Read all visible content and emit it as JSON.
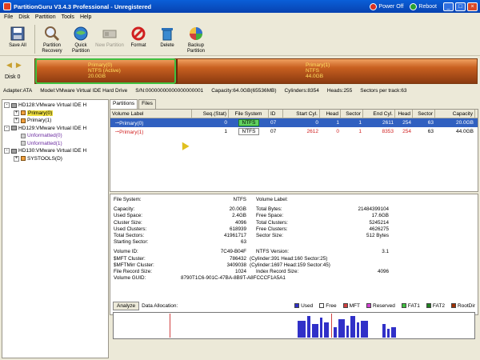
{
  "window": {
    "title": "PartitionGuru V3.4.3 Professional - Unregistered",
    "power_off": "Power Off",
    "reboot": "Reboot"
  },
  "menu": [
    "File",
    "Disk",
    "Partition",
    "Tools",
    "Help"
  ],
  "toolbar": [
    {
      "label": "Save All",
      "icon": "save-icon",
      "enabled": true
    },
    {
      "label": "Partition Recovery",
      "icon": "magnifier-icon",
      "enabled": true
    },
    {
      "label": "Quick Partition",
      "icon": "globe-icon",
      "enabled": true
    },
    {
      "label": "New Partition",
      "icon": "new-partition-icon",
      "enabled": false
    },
    {
      "label": "Format",
      "icon": "format-icon",
      "enabled": true
    },
    {
      "label": "Delete",
      "icon": "trash-icon",
      "enabled": true
    },
    {
      "label": "Backup Partition",
      "icon": "backup-icon",
      "enabled": true
    }
  ],
  "diskmap": {
    "disk_label": "Disk  0",
    "partitions": [
      {
        "name": "Primary(0)",
        "fs": "NTFS (Active)",
        "size": "20.0GB"
      },
      {
        "name": "Primary(1)",
        "fs": "NTFS",
        "size": "44.0GB"
      }
    ]
  },
  "info": {
    "adapter": "Adapter:ATA",
    "model": "Model:VMware Virtual IDE Hard Drive",
    "sn": "S/N:00000000000000000001",
    "capacity": "Capacity:64.0GB(65536MB)",
    "cylinders": "Cylinders:8354",
    "heads": "Heads:255",
    "sectors": "Sectors per track:63"
  },
  "tree": [
    {
      "level": 1,
      "type": "disk",
      "label": "HD128:VMware Virtual IDE H",
      "exp": "-"
    },
    {
      "level": 2,
      "type": "part",
      "label": "Primary(0)",
      "exp": "+",
      "selected": true
    },
    {
      "level": 2,
      "type": "part",
      "label": "Primary(1)",
      "exp": "+"
    },
    {
      "level": 1,
      "type": "disk",
      "label": "HD129:VMware Virtual IDE H",
      "exp": "-"
    },
    {
      "level": 2,
      "type": "unf",
      "label": "Unformatted(0)",
      "exp": ""
    },
    {
      "level": 2,
      "type": "unf",
      "label": "Unformatted(1)",
      "exp": ""
    },
    {
      "level": 1,
      "type": "disk",
      "label": "HD130:VMware Virtual IDE H",
      "exp": "-"
    },
    {
      "level": 2,
      "type": "part",
      "label": "SYSTOOLS(D)",
      "exp": "+"
    }
  ],
  "tabs": [
    "Partitions",
    "Files"
  ],
  "table": {
    "headers": [
      "Volume Label",
      "Seq.(Stat)",
      "File System",
      "ID",
      "Start Cyl.",
      "Head",
      "Sector",
      "End Cyl.",
      "Head",
      "Sector",
      "Capacity"
    ],
    "rows": [
      {
        "label": "Primary(0)",
        "seq": "0",
        "fs": "NTFS",
        "id": "07",
        "start_cyl": "0",
        "head": "1",
        "sector": "1",
        "end_cyl": "2611",
        "end_head": "254",
        "end_sector": "63",
        "capacity": "20.0GB"
      },
      {
        "label": "Primary(1)",
        "seq": "1",
        "fs": "NTFS",
        "id": "07",
        "start_cyl": "2612",
        "head": "0",
        "sector": "1",
        "end_cyl": "8353",
        "end_head": "254",
        "end_sector": "63",
        "capacity": "44.0GB"
      }
    ]
  },
  "details": {
    "file_system_k": "File System:",
    "file_system_v": "NTFS",
    "volume_label_k": "Volume Label:",
    "volume_label_v": "",
    "capacity_k": "Capacity:",
    "capacity_v": "20.0GB",
    "total_bytes_k": "Total Bytes:",
    "total_bytes_v": "21484399104",
    "used_k": "Used Space:",
    "used_v": "2.4GB",
    "free_k": "Free Space:",
    "free_v": "17.6GB",
    "cluster_size_k": "Cluster Size:",
    "cluster_size_v": "4096",
    "total_clusters_k": "Total Clusters:",
    "total_clusters_v": "5245214",
    "used_clusters_k": "Used Clusters:",
    "used_clusters_v": "618939",
    "free_clusters_k": "Free Clusters:",
    "free_clusters_v": "4626275",
    "total_sectors_k": "Total Sectors:",
    "total_sectors_v": "41961717",
    "sector_size_k": "Sector Size:",
    "sector_size_v": "512 Bytes",
    "starting_sector_k": "Starting Sector:",
    "starting_sector_v": "63",
    "volume_id_k": "Volume ID:",
    "volume_id_v": "7C49-B04F",
    "ntfs_version_k": "NTFS Version:",
    "ntfs_version_v": "3.1",
    "mft_cluster_k": "$MFT Cluster:",
    "mft_cluster_v": "786432",
    "mft_cluster_x": "(Cylinder:391 Head:160 Sector:25)",
    "mftmirr_k": "$MFTMirr Cluster:",
    "mftmirr_v": "3409038",
    "mftmirr_x": "(Cylinder:1697 Head:159 Sector:45)",
    "frs_k": "File Record Size:",
    "frs_v": "1024",
    "irs_k": "Index Record Size:",
    "irs_v": "4096",
    "guid_k": "Volume GUID:",
    "guid_v": "8790T1C6-901C-47BA-8B9T-A8FCCCF1A5A1"
  },
  "analyze": {
    "button": "Analyze",
    "label": "Data Allocation:",
    "legend": [
      {
        "name": "Used",
        "color": "#3030c8"
      },
      {
        "name": "Free",
        "color": "#ffffff"
      },
      {
        "name": "MFT",
        "color": "#d04040"
      },
      {
        "name": "Reserved",
        "color": "#d040d0"
      },
      {
        "name": "FAT1",
        "color": "#40c040"
      },
      {
        "name": "FAT2",
        "color": "#208020"
      },
      {
        "name": "RootDir",
        "color": "#a03000"
      }
    ]
  }
}
